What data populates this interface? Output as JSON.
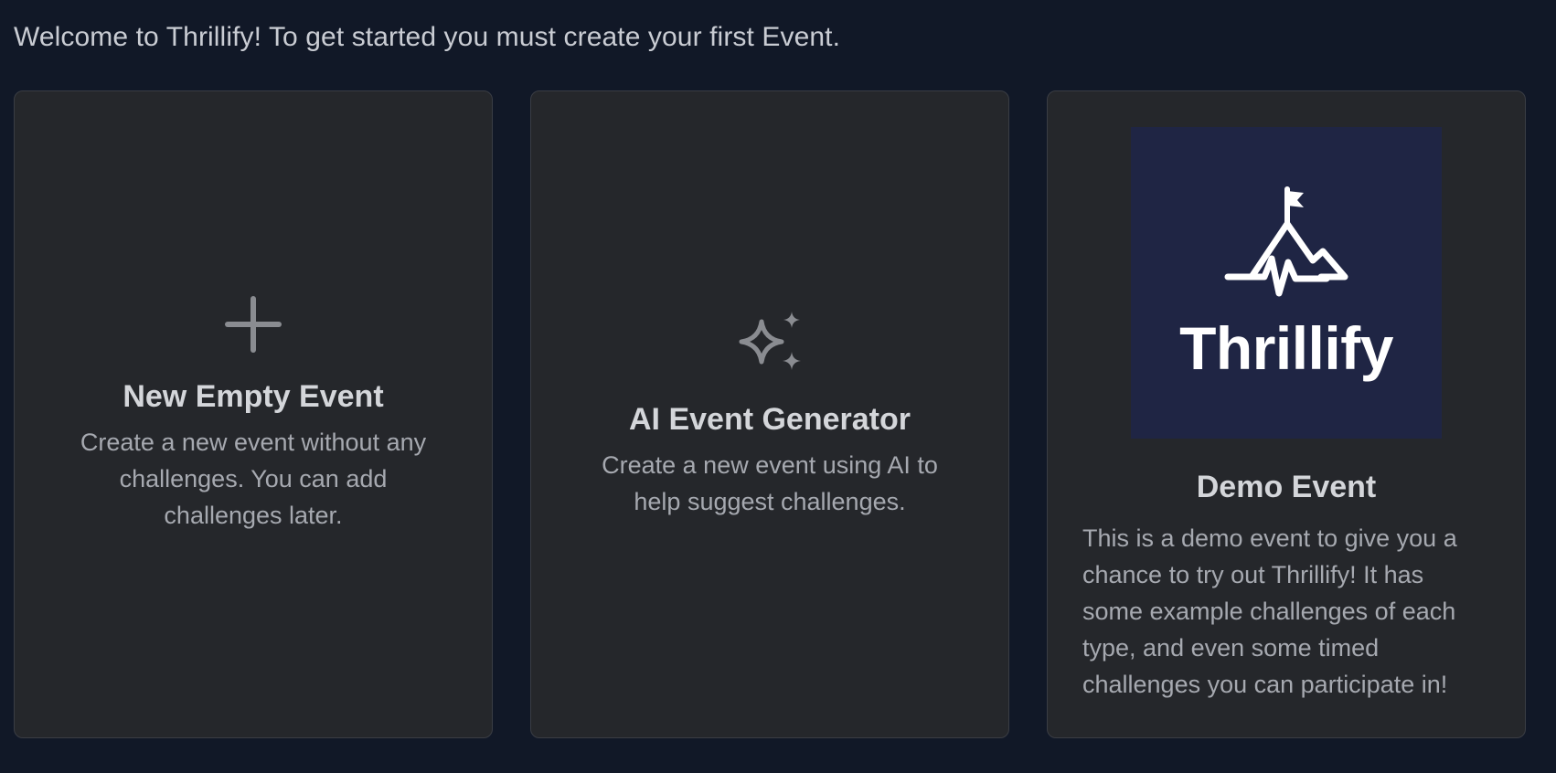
{
  "welcome_text": "Welcome to Thrillify! To get started you must create your first Event.",
  "cards": {
    "new_event": {
      "icon": "plus-icon",
      "title": "New Empty Event",
      "description": "Create a new event without any challenges. You can add challenges later."
    },
    "ai_event": {
      "icon": "sparkles-icon",
      "title": "AI Event Generator",
      "description": "Create a new event using AI to help suggest challenges."
    },
    "demo_event": {
      "icon": "thrillify-logo",
      "logo_text": "Thrillify",
      "title": "Demo Event",
      "description": "This is a demo event to give you a chance to try out Thrillify! It has some example challenges of each type, and even some timed challenges you can participate in!"
    }
  },
  "colors": {
    "background": "#111827",
    "card_background": "#25272b",
    "card_border": "#3a3d44",
    "logo_background": "#1f2544",
    "icon_color": "#8a8c91"
  }
}
